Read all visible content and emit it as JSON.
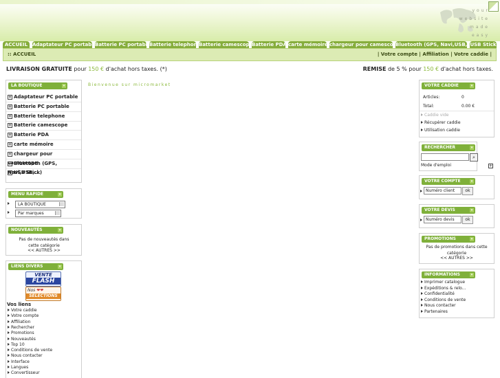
{
  "header": {
    "tagline": [
      "your",
      "website",
      "made",
      "easy"
    ]
  },
  "tabs": [
    "ACCUEIL",
    "Adaptateur PC portable",
    "Batterie PC portable",
    "Batterie telephone",
    "Batterie camescope",
    "Batterie PDA",
    "carte mémoire",
    "chargeur pour camescope",
    "Bluetooth (GPS, Navi,USB,...)",
    "USB Stick"
  ],
  "navbar": {
    "breadcrumb": ":: ACCUEIL",
    "links": "| Votre compte | Affiliation | Votre caddie |"
  },
  "promo": {
    "left_bold": "LIVRAISON GRATUITE",
    "left_pre": " pour ",
    "left_amount": "150 €",
    "left_post": " d'achat hors taxes. (*)",
    "right_bold": "REMISE",
    "right_pre": " de 5 % pour ",
    "right_amount": "150 €",
    "right_post": " d'achat hors taxes."
  },
  "welcome": "Bienvenue sur micromarket",
  "boutique": {
    "title": "LA BOUTIQUE",
    "items": [
      "Adaptateur PC portable",
      "Batterie PC portable",
      "Batterie telephone",
      "Batterie camescope",
      "Batterie PDA",
      "carte mémoire",
      "chargeur pour camescope",
      "Bluetooth (GPS, Navi,USB,...)",
      "USB Stick"
    ]
  },
  "menu_rapide": {
    "title": "MENU RAPIDE",
    "select1": "LA BOUTIQUE",
    "select2": "Par marques"
  },
  "nouveautes": {
    "title": "NOUVEAUTÉS",
    "text": "Pas de nouveautés dans cette catégorie",
    "more": "<< AUTRES >>"
  },
  "liens": {
    "title": "LIENS DIVERS",
    "badge1_top": "VENTE",
    "badge1_bottom": "FLASH",
    "badge2_top": "Nos",
    "badge2_bottom": "SELECTIONS",
    "heading": "Vos liens",
    "items": [
      "Votre caddie",
      "Votre compte",
      "Affiliation",
      "Rechercher",
      "Promotions",
      "Nouveautés",
      "Top 10",
      "Conditions de vente",
      "Nous contacter",
      "Interface",
      "Langues",
      "Convertisseur"
    ]
  },
  "caddie": {
    "title": "VOTRE CADDIE",
    "articles_label": "Articles:",
    "articles_value": "0",
    "total_label": "Total:",
    "total_value": "0.00 €",
    "links": [
      "Caddie vide",
      "Récupérer caddie",
      "Utilisation caddie"
    ]
  },
  "recherche": {
    "title": "RECHERCHER",
    "mode": "Mode d'emploi"
  },
  "compte": {
    "title": "VOTRE COMPTE",
    "placeholder": "Numéro client",
    "ok": "ok"
  },
  "devis": {
    "title": "VOTRE DEVIS",
    "placeholder": "Numéro devis",
    "ok": "ok"
  },
  "promotions": {
    "title": "PROMOTIONS",
    "text": "Pas de promotions dans cette catégorie",
    "more": "<< AUTRES >>"
  },
  "infos": {
    "title": "INFORMATIONS",
    "items": [
      "Imprimer catalogue",
      "Expéditions & relo...",
      "Confidentialité",
      "Conditions de vente",
      "Nous contacter",
      "Partenaires"
    ]
  }
}
